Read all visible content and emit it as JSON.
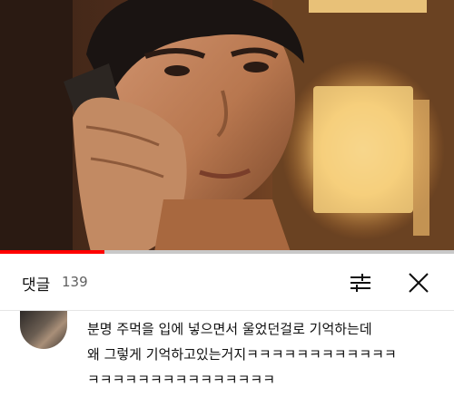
{
  "video": {
    "progress_fraction": 0.23
  },
  "comments_panel": {
    "title": "댓글",
    "count": "139",
    "icons": {
      "sort": "sort-filter-icon",
      "close": "close-icon"
    }
  },
  "comment": {
    "lines": [
      "분명 주먹을 입에 넣으면서 울었던걸로 기억하는데",
      "왜 그렇게 기억하고있는거지ㅋㅋㅋㅋㅋㅋㅋㅋㅋㅋㅋㅋ",
      "ㅋㅋㅋㅋㅋㅋㅋㅋㅋㅋㅋㅋㅋㅋㅋ"
    ]
  },
  "colors": {
    "progress": "#ff0000",
    "text": "#0f0f0f",
    "muted": "#606060"
  }
}
